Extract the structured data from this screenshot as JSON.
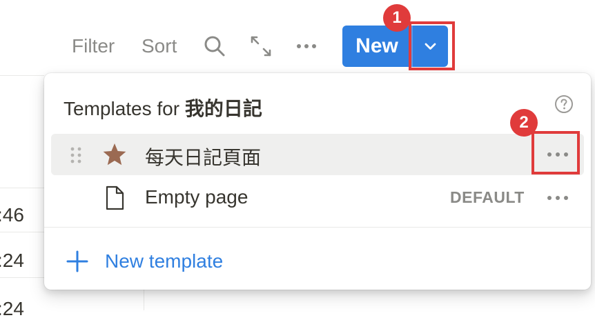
{
  "toolbar": {
    "filter_label": "Filter",
    "sort_label": "Sort",
    "search_icon": "search-icon",
    "expand_icon": "expand-icon",
    "more_icon": "more-icon",
    "new_label": "New",
    "dropdown_icon": "chevron-down-icon",
    "accent_color": "#2f7fe0"
  },
  "annotations": {
    "badge_1": "1",
    "badge_2": "2",
    "color": "#e03b3b"
  },
  "background": {
    "times": [
      ":46",
      ":24",
      ":24"
    ]
  },
  "popup": {
    "title_prefix": "Templates for",
    "title_db": "我的日記",
    "help_icon": "help-circle-icon",
    "templates": [
      {
        "label": "每天日記頁面",
        "icon": "star-icon",
        "icon_color": "#9b6a52",
        "hovered": true
      },
      {
        "label": "Empty page",
        "icon": "page-icon",
        "badge": "DEFAULT",
        "hovered": false
      }
    ],
    "new_template_label": "New template"
  }
}
